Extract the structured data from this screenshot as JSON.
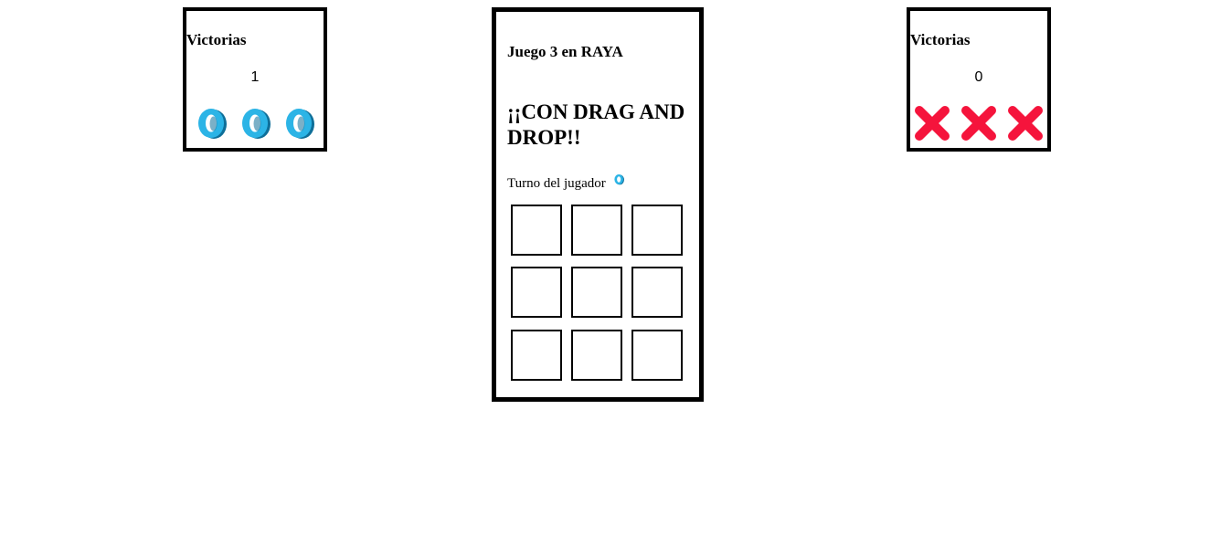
{
  "left_panel": {
    "title": "Victorias",
    "wins": "1",
    "piece": "o-ring-icon",
    "piece_color": "#1fa3d6",
    "piece_count": 3
  },
  "right_panel": {
    "title": "Victorias",
    "wins": "0",
    "piece": "x-cross-icon",
    "piece_color": "#f5143c",
    "piece_count": 3
  },
  "game": {
    "title": "Juego 3 en RAYA",
    "subtitle": "¡¡CON DRAG AND DROP!!",
    "turn_label": "Turno del jugador",
    "turn_icon": "o-ring-icon",
    "board": [
      "",
      "",
      "",
      "",
      "",
      "",
      "",
      "",
      ""
    ]
  }
}
